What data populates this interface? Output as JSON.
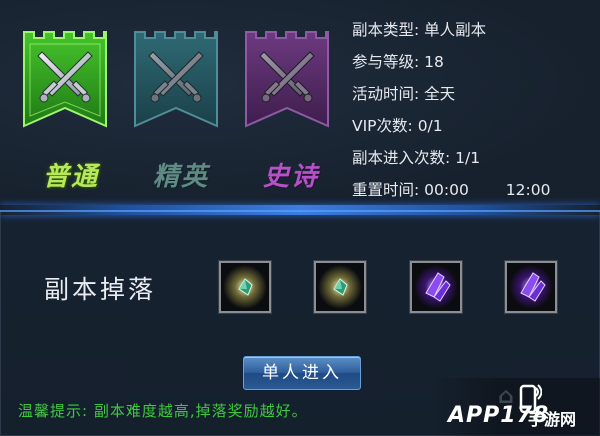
{
  "difficulties": [
    {
      "label": "普通",
      "theme": "green",
      "color": "#2f8f1f",
      "selected": true
    },
    {
      "label": "精英",
      "theme": "teal",
      "color": "#2c5b64",
      "selected": false
    },
    {
      "label": "史诗",
      "theme": "purple",
      "color": "#5a2a6a",
      "selected": false
    }
  ],
  "info": {
    "type_label": "副本类型:",
    "type_value": "单人副本",
    "level_label": "参与等级:",
    "level_value": "18",
    "time_label": "活动时间:",
    "time_value": "全天",
    "vip_label": "VIP次数:",
    "vip_value": "0/1",
    "entries_label": "副本进入次数:",
    "entries_value": "1/1",
    "reset_label": "重置时间:",
    "reset_times": [
      "00:00",
      "12:00"
    ]
  },
  "drops": {
    "label": "副本掉落",
    "items": [
      {
        "icon": "green-gem-icon"
      },
      {
        "icon": "green-gem-icon"
      },
      {
        "icon": "purple-crystal-icon"
      },
      {
        "icon": "purple-crystal-icon"
      }
    ]
  },
  "enter_button": "单人进入",
  "tip": "温馨提示: 副本难度越高,掉落奖励越好。",
  "watermark": {
    "brand": "APP178",
    "sub": "手游网"
  },
  "colors": {
    "accent_blue": "#3b7ee0",
    "tip_green": "#3ec83e"
  }
}
